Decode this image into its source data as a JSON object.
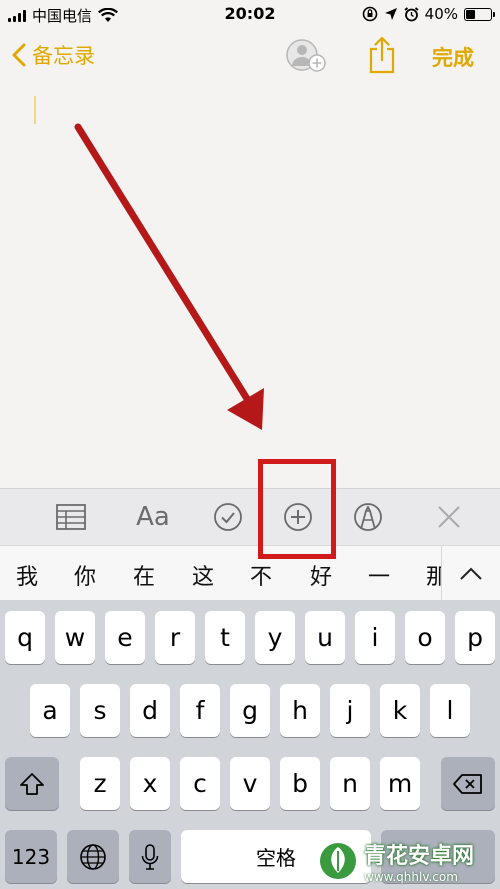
{
  "status": {
    "carrier": "中国电信",
    "time": "20:02",
    "battery": "40%",
    "battery_level": 0.4
  },
  "nav": {
    "back_label": "备忘录",
    "done_label": "完成"
  },
  "toolbar": {
    "table_icon": "table-icon",
    "format_label": "Aa",
    "checklist_icon": "checklist-icon",
    "add_icon": "plus-circle-icon",
    "markup_icon": "markup-icon",
    "close_icon": "close-icon"
  },
  "candidates": [
    "我",
    "你",
    "在",
    "这",
    "不",
    "好",
    "一",
    "那"
  ],
  "keyboard": {
    "row1": [
      "q",
      "w",
      "e",
      "r",
      "t",
      "y",
      "u",
      "i",
      "o",
      "p"
    ],
    "row2": [
      "a",
      "s",
      "d",
      "f",
      "g",
      "h",
      "j",
      "k",
      "l"
    ],
    "row3": [
      "z",
      "x",
      "c",
      "v",
      "b",
      "n",
      "m"
    ],
    "num_label": "123",
    "space_label": "空格"
  },
  "watermark": {
    "text": "青花安卓网",
    "url": "www.qhhlv.com"
  },
  "colors": {
    "accent": "#e0a800",
    "annotation": "#d11a1a"
  }
}
